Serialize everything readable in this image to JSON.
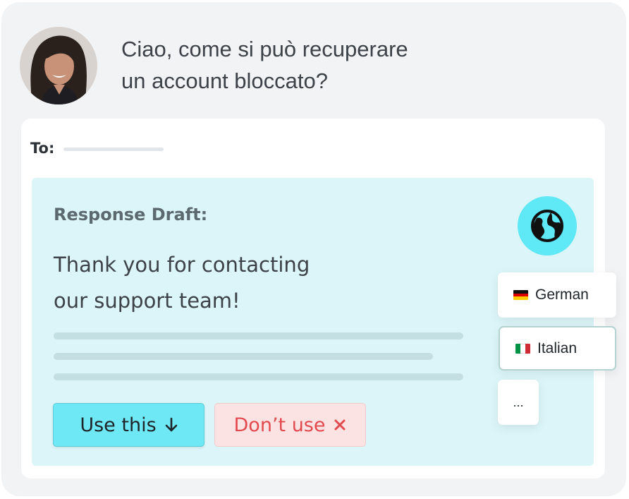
{
  "message": {
    "line1": "Ciao, come si può recuperare",
    "line2": "un account bloccato?"
  },
  "mail": {
    "to_label": "To:"
  },
  "draft": {
    "title": "Response Draft:",
    "body_line1": "Thank you for contacting",
    "body_line2": "our support team!"
  },
  "actions": {
    "use_label": "Use this",
    "dont_use_label": "Don’t use"
  },
  "languages": [
    {
      "label": "German",
      "flag": "de-flag-icon"
    },
    {
      "label": "Italian",
      "flag": "it-flag-icon"
    },
    {
      "label": "..."
    }
  ],
  "icons": {
    "globe": "globe-icon",
    "use": "arrow-down-icon",
    "dont_use": "close-icon"
  },
  "colors": {
    "accent": "#5fe8f5",
    "use_button": "#6ee8f4",
    "dont_use_text": "#e24a4f",
    "draft_bg": "#dbf5f8"
  }
}
